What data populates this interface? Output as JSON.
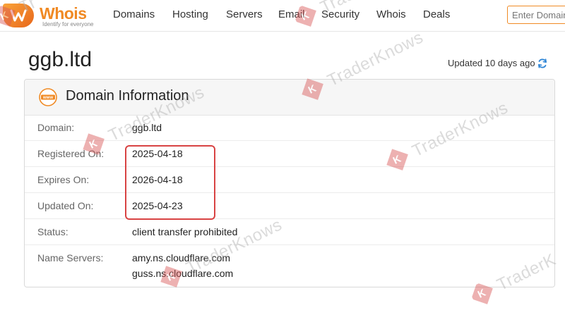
{
  "brand": {
    "name": "Whois",
    "tagline": "Identify for everyone",
    "color": "#f08a24"
  },
  "nav": {
    "items": [
      {
        "label": "Domains"
      },
      {
        "label": "Hosting"
      },
      {
        "label": "Servers"
      },
      {
        "label": "Email"
      },
      {
        "label": "Security"
      },
      {
        "label": "Whois"
      },
      {
        "label": "Deals"
      }
    ]
  },
  "search": {
    "placeholder": "Enter Domain"
  },
  "page": {
    "domain": "ggb.ltd",
    "updated": "Updated 10 days ago",
    "refresh_icon": "refresh-icon"
  },
  "card": {
    "icon": "www-icon",
    "title": "Domain Information",
    "rows": [
      {
        "label": "Domain:",
        "value": "ggb.ltd"
      },
      {
        "label": "Registered On:",
        "value": "2025-04-18"
      },
      {
        "label": "Expires On:",
        "value": "2026-04-18"
      },
      {
        "label": "Updated On:",
        "value": "2025-04-23"
      },
      {
        "label": "Status:",
        "value": "client transfer prohibited"
      }
    ],
    "name_servers": {
      "label": "Name Servers:",
      "values": [
        "amy.ns.cloudflare.com",
        "guss.ns.cloudflare.com"
      ]
    },
    "highlight_color": "#d84343"
  },
  "watermark": {
    "text": "TraderKnows",
    "badge_letter": "K",
    "color": "#d85555"
  }
}
